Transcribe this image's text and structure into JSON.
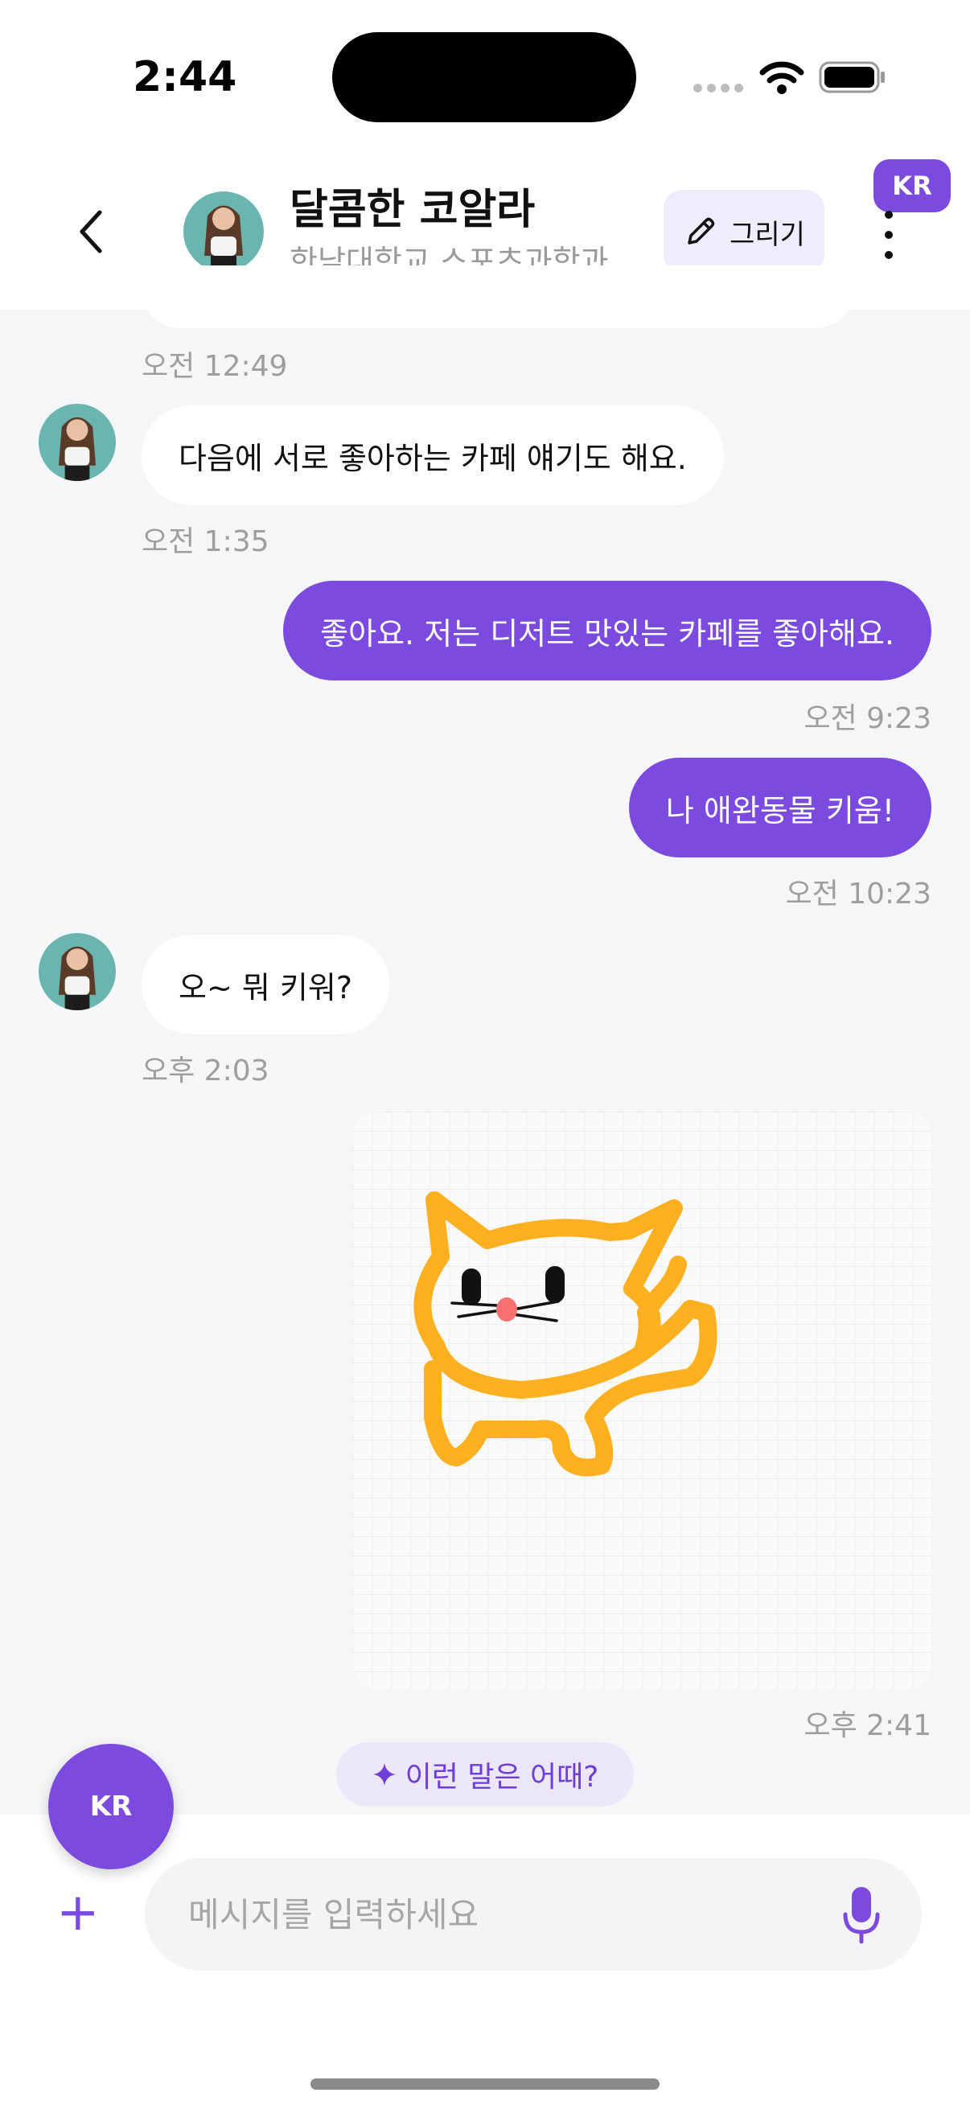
{
  "status_bar": {
    "time": "2:44"
  },
  "header": {
    "title": "달콤한 코알라",
    "subtitle": "한남대학교 스포츠과학과",
    "draw_label": "그리기",
    "lang_badge": "KR"
  },
  "messages": [
    {
      "side": "in",
      "text": "",
      "time": "오전 12:49"
    },
    {
      "side": "in",
      "text": "다음에 서로 좋아하는 카페 얘기도 해요.",
      "time": "오전 1:35"
    },
    {
      "side": "out",
      "text": "좋아요. 저는 디저트 맛있는 카페를 좋아해요.",
      "time": "오전 9:23"
    },
    {
      "side": "out",
      "text": "나 애완동물 키움!",
      "time": "오전 10:23"
    },
    {
      "side": "in",
      "text": "오~ 뭐 키워?",
      "time": "오후 2:03"
    },
    {
      "side": "out",
      "type": "drawing",
      "time": "오후 2:41"
    }
  ],
  "suggestion": {
    "label": "이런 말은 어때?"
  },
  "fab": {
    "label": "KR"
  },
  "composer": {
    "placeholder": "메시지를 입력하세요",
    "value": ""
  },
  "colors": {
    "accent": "#7b4be0",
    "cat_stroke": "#ffb020",
    "nose": "#f87171"
  }
}
